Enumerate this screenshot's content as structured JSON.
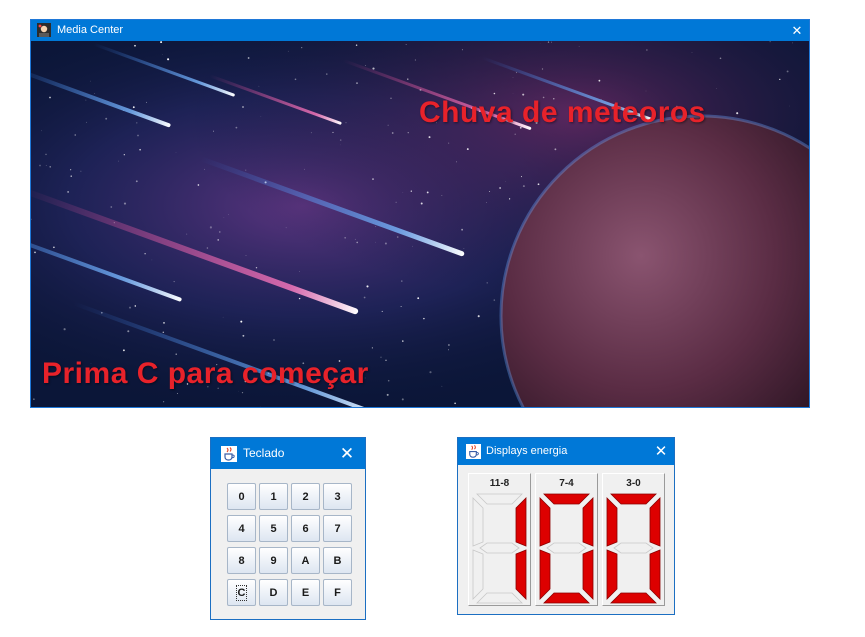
{
  "media_center": {
    "title": "Media Center",
    "close_glyph": "✕",
    "headline": "Chuva de meteoros",
    "prompt": "Prima C para começar",
    "headline_color": "#e8222a"
  },
  "keypad": {
    "title": "Teclado",
    "close_glyph": "✕",
    "keys": [
      "0",
      "1",
      "2",
      "3",
      "4",
      "5",
      "6",
      "7",
      "8",
      "9",
      "A",
      "B",
      "C",
      "D",
      "E",
      "F"
    ],
    "focused_key": "C"
  },
  "displays": {
    "title": "Displays energia",
    "close_glyph": "✕",
    "segment_on_color": "#dd0000",
    "segment_off_color": "#f0f0f0",
    "digits": [
      {
        "label": "11-8",
        "value": "1"
      },
      {
        "label": "7-4",
        "value": "0"
      },
      {
        "label": "3-0",
        "value": "0"
      }
    ]
  },
  "icons": {
    "media_center_app": "avatar-app-icon",
    "java_app": "java-cup-icon"
  }
}
